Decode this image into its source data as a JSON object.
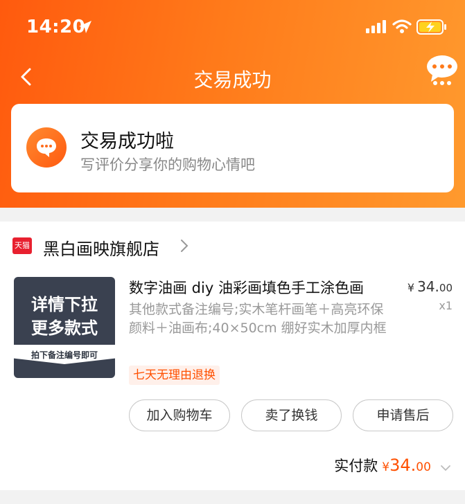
{
  "status_bar": {
    "time": "14:20"
  },
  "nav": {
    "title": "交易成功"
  },
  "success_card": {
    "heading": "交易成功啦",
    "subtitle": "写评价分享你的购物心情吧"
  },
  "order": {
    "shop_badge": "天猫",
    "shop_name": "黑白画映旗舰店",
    "thumbnail": {
      "line1": "详情下拉",
      "line2": "更多款式",
      "band_text": "拍下备注编号即可"
    },
    "product_name": "数字油画 diy 油彩画填色手工涂色画",
    "product_spec": "其他款式备注编号;实木笔杆画笔＋高亮环保颜料＋油画布;40×50cm 绷好实木加厚内框",
    "price_currency": "¥",
    "price_int": "34.",
    "price_dec": "00",
    "quantity": "x1",
    "tag": "七天无理由退换",
    "buttons": {
      "add_cart": "加入购物车",
      "resell": "卖了换钱",
      "after_sale": "申请售后"
    },
    "total_label": "实付款",
    "total_currency": "¥",
    "total_int": "34.",
    "total_dec": "00"
  },
  "colors": {
    "brand_orange": "#ff5a0e",
    "price_orange": "#ff5000",
    "tmall_red": "#e8202f"
  },
  "icons": [
    "location-arrow-icon",
    "signal-icon",
    "wifi-icon",
    "battery-charging-icon",
    "back-icon",
    "more-chat-icon",
    "chat-bubble-icon",
    "chevron-right-icon",
    "chevron-down-icon"
  ]
}
